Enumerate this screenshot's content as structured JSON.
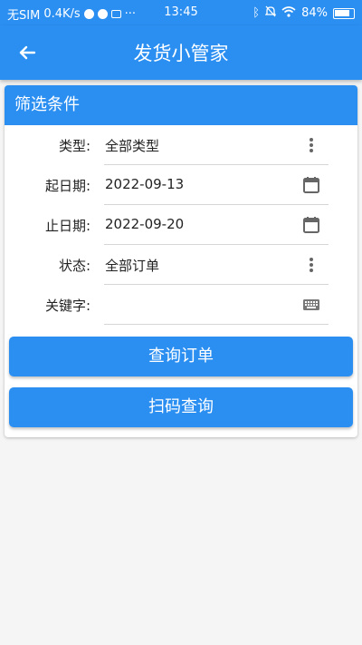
{
  "status_bar": {
    "carrier": "无SIM",
    "speed": "0.4K/s",
    "time": "13:45",
    "battery": "84%"
  },
  "app_bar": {
    "title": "发货小管家",
    "back_icon": "arrow-left-icon"
  },
  "filter_card": {
    "title": "筛选条件",
    "fields": [
      {
        "label": "类型:",
        "value": "全部类型",
        "icon": "more-vertical-icon"
      },
      {
        "label": "起日期:",
        "value": "2022-09-13",
        "icon": "calendar-icon"
      },
      {
        "label": "止日期:",
        "value": "2022-09-20",
        "icon": "calendar-icon"
      },
      {
        "label": "状态:",
        "value": "全部订单",
        "icon": "more-vertical-icon"
      },
      {
        "label": "关键字:",
        "value": "",
        "icon": "keyboard-icon"
      }
    ],
    "buttons": {
      "query_label": "查询订单",
      "scan_label": "扫码查询"
    }
  },
  "colors": {
    "primary": "#2b8ff2",
    "background": "#f5f5f5"
  }
}
